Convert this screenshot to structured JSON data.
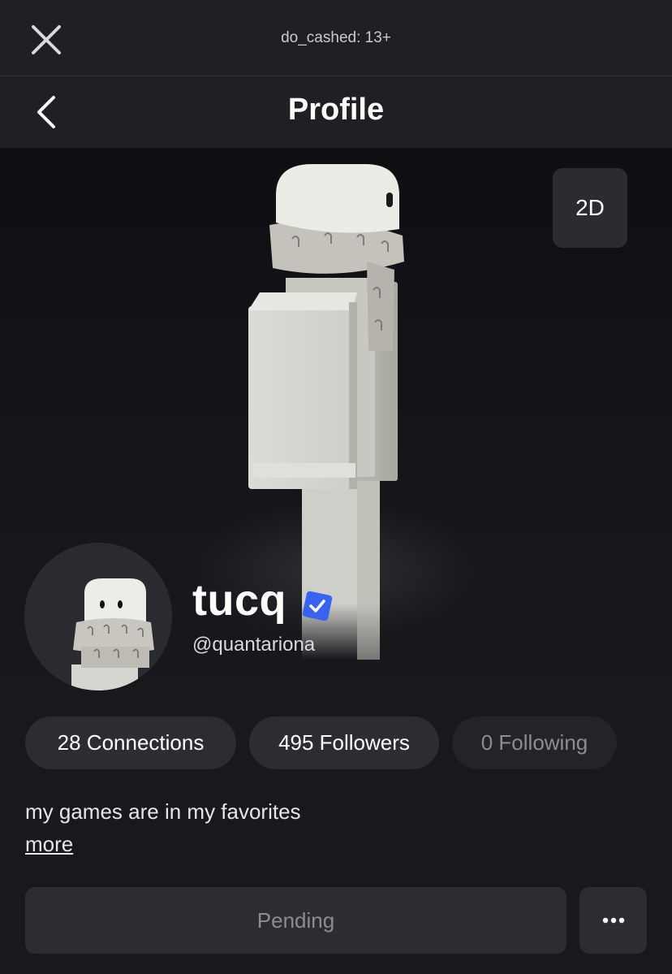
{
  "topbar": {
    "title": "do_cashed: 13+",
    "close_icon": "close-icon"
  },
  "header": {
    "title": "Profile",
    "back_icon": "chevron-left-icon"
  },
  "stage": {
    "toggle_label": "2D"
  },
  "profile": {
    "display_name": "tucq",
    "username": "@quantariona",
    "verified_icon": "verified-check-icon",
    "badge_color": "#3763f4"
  },
  "stats": {
    "connections": "28 Connections",
    "followers": "495 Followers",
    "following": "0 Following"
  },
  "bio": {
    "text": "my games are in my favorites",
    "more_label": "more"
  },
  "actions": {
    "pending_label": "Pending",
    "more_icon": "ellipsis-icon"
  }
}
